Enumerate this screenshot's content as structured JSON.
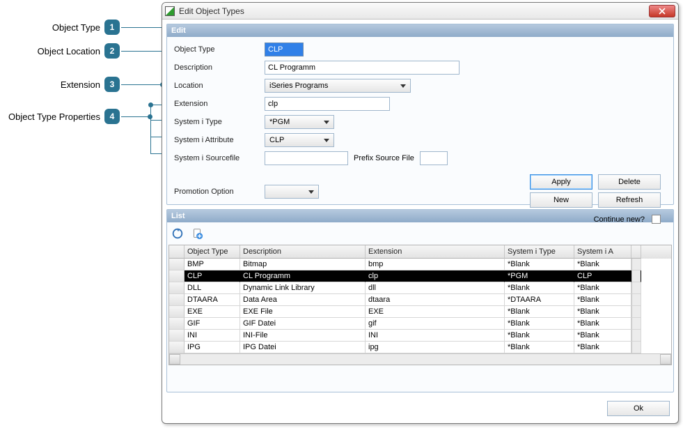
{
  "annotations": [
    {
      "n": "1",
      "label": "Object Type"
    },
    {
      "n": "2",
      "label": "Object Location"
    },
    {
      "n": "3",
      "label": "Extension"
    },
    {
      "n": "4",
      "label": "Object Type Properties"
    }
  ],
  "window": {
    "title": "Edit Object Types"
  },
  "edit": {
    "header": "Edit",
    "labels": {
      "object_type": "Object Type",
      "description": "Description",
      "location": "Location",
      "extension": "Extension",
      "system_i_type": "System i Type",
      "system_i_attribute": "System i Attribute",
      "system_i_sourcefile": "System i Sourcefile",
      "prefix_source_file": "Prefix Source File",
      "promotion_option": "Promotion Option",
      "continue_new": "Continue new?"
    },
    "values": {
      "object_type": "CLP",
      "description": "CL Programm",
      "location": "iSeries Programs",
      "extension": "clp",
      "system_i_type": "*PGM",
      "system_i_attribute": "CLP",
      "system_i_sourcefile": "",
      "prefix_source_file": "",
      "promotion_option": ""
    },
    "buttons": {
      "apply": "Apply",
      "delete": "Delete",
      "new": "New",
      "refresh": "Refresh"
    }
  },
  "list": {
    "header": "List",
    "columns": [
      "Object Type",
      "Description",
      "Extension",
      "System i Type",
      "System i A"
    ],
    "rows": [
      {
        "obj": "BMP",
        "desc": "Bitmap",
        "ext": "bmp",
        "sit": "*Blank",
        "sia": "*Blank",
        "selected": false
      },
      {
        "obj": "CLP",
        "desc": "CL Programm",
        "ext": "clp",
        "sit": "*PGM",
        "sia": "CLP",
        "selected": true
      },
      {
        "obj": "DLL",
        "desc": "Dynamic Link Library",
        "ext": "dll",
        "sit": "*Blank",
        "sia": "*Blank",
        "selected": false
      },
      {
        "obj": "DTAARA",
        "desc": "Data Area",
        "ext": "dtaara",
        "sit": "*DTAARA",
        "sia": "*Blank",
        "selected": false
      },
      {
        "obj": "EXE",
        "desc": "EXE File",
        "ext": "EXE",
        "sit": "*Blank",
        "sia": "*Blank",
        "selected": false
      },
      {
        "obj": "GIF",
        "desc": "GIF Datei",
        "ext": "gif",
        "sit": "*Blank",
        "sia": "*Blank",
        "selected": false
      },
      {
        "obj": "INI",
        "desc": "INI-File",
        "ext": "INI",
        "sit": "*Blank",
        "sia": "*Blank",
        "selected": false
      },
      {
        "obj": "IPG",
        "desc": "IPG Datei",
        "ext": "ipg",
        "sit": "*Blank",
        "sia": "*Blank",
        "selected": false
      }
    ]
  },
  "footer": {
    "ok": "Ok"
  }
}
